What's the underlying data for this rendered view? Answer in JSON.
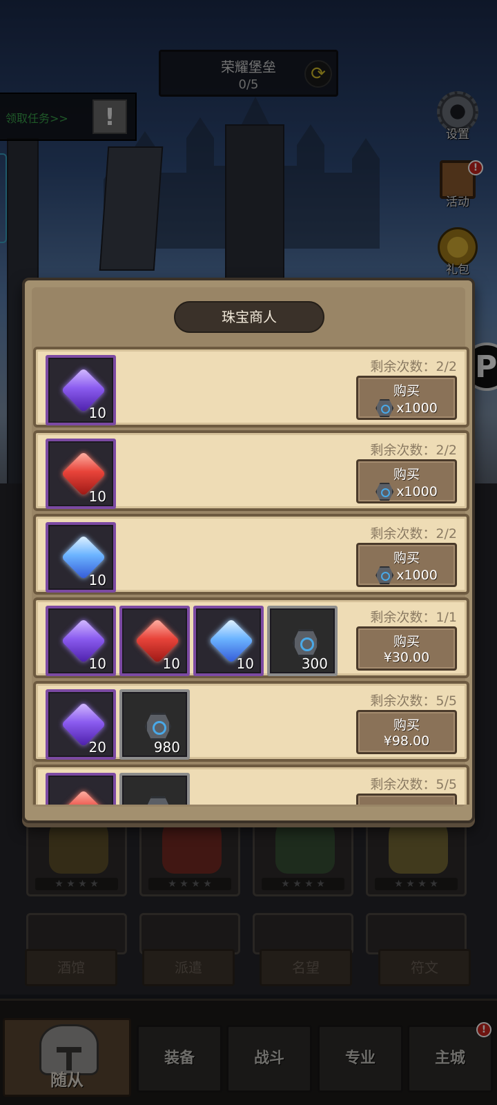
{
  "top_banner": {
    "title": "荣耀堡垒",
    "progress": "0/5"
  },
  "quest": {
    "label": "领取任务>>",
    "alert": "!"
  },
  "side_menu": [
    {
      "label": "设置",
      "icon": "gear-icon"
    },
    {
      "label": "活动",
      "icon": "scroll-icon",
      "badge": "!"
    },
    {
      "label": "礼包",
      "icon": "chest-icon"
    }
  ],
  "shop": {
    "title": "珠宝商人",
    "remain_prefix": "剩余次数：",
    "buy_label": "购买",
    "offers": [
      {
        "remain": "2/2",
        "price": "x1000",
        "price_type": "coin",
        "items": [
          {
            "type": "purple-gem",
            "qty": "10"
          }
        ]
      },
      {
        "remain": "2/2",
        "price": "x1000",
        "price_type": "coin",
        "items": [
          {
            "type": "red-gem",
            "qty": "10"
          }
        ]
      },
      {
        "remain": "2/2",
        "price": "x1000",
        "price_type": "coin",
        "items": [
          {
            "type": "blue-gem",
            "qty": "10"
          }
        ]
      },
      {
        "remain": "1/1",
        "price": "¥30.00",
        "price_type": "cash",
        "items": [
          {
            "type": "purple-gem",
            "qty": "10"
          },
          {
            "type": "red-gem",
            "qty": "10"
          },
          {
            "type": "blue-gem",
            "qty": "10"
          },
          {
            "type": "coin",
            "qty": "300"
          }
        ]
      },
      {
        "remain": "5/5",
        "price": "¥98.00",
        "price_type": "cash",
        "items": [
          {
            "type": "purple-gem",
            "qty": "20"
          },
          {
            "type": "coin",
            "qty": "980"
          }
        ]
      },
      {
        "remain": "5/5",
        "price": "",
        "price_type": "cash",
        "items": [
          {
            "type": "purple-gem",
            "qty": ""
          },
          {
            "type": "coin",
            "qty": ""
          }
        ]
      }
    ]
  },
  "sub_tabs": [
    "酒馆",
    "派遣",
    "名望",
    "符文"
  ],
  "bottom_nav": [
    {
      "label": "随从",
      "active": true
    },
    {
      "label": "装备"
    },
    {
      "label": "战斗"
    },
    {
      "label": "专业"
    },
    {
      "label": "主城",
      "badge": "!"
    }
  ],
  "hero_stars": "★ ★ ★ ★",
  "colors": {
    "accent_purple": "#7c4aa3",
    "accent_green": "#3aa34a",
    "parchment": "#eedcb5",
    "badge_red": "#c8251e"
  }
}
